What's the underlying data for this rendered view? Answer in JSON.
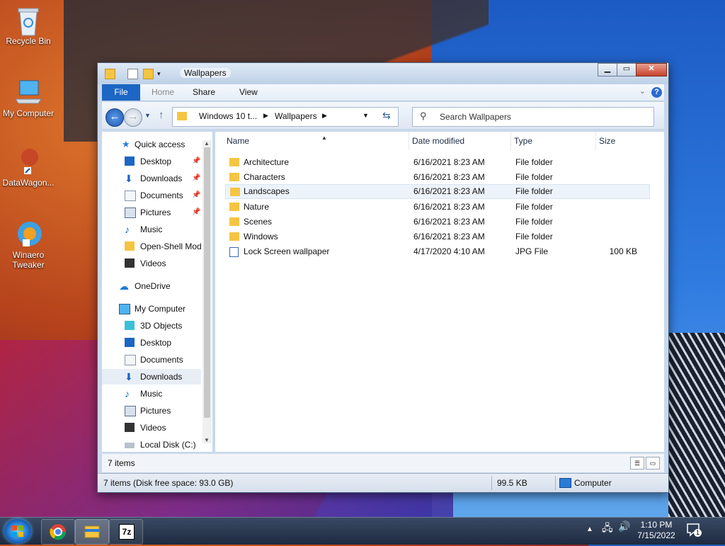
{
  "desktop": {
    "icons": [
      {
        "label": "Recycle Bin"
      },
      {
        "label": "My Computer"
      },
      {
        "label": "DataWagon..."
      },
      {
        "label": "Winaero Tweaker"
      }
    ]
  },
  "window": {
    "title": "Wallpapers",
    "ribbon": {
      "file": "File",
      "home": "Home",
      "share": "Share",
      "view": "View",
      "help": "?"
    },
    "address": {
      "crumbs": [
        "Windows 10 t...",
        "Wallpapers"
      ]
    },
    "search": {
      "placeholder": "Search Wallpapers"
    },
    "nav_pane": {
      "items": [
        {
          "label": "Quick access",
          "icon": "star-icon"
        },
        {
          "label": "Desktop",
          "icon": "desktop-icon",
          "pinned": true
        },
        {
          "label": "Downloads",
          "icon": "download-icon",
          "pinned": true
        },
        {
          "label": "Documents",
          "icon": "documents-icon",
          "pinned": true
        },
        {
          "label": "Pictures",
          "icon": "pictures-icon",
          "pinned": true
        },
        {
          "label": "Music",
          "icon": "music-icon"
        },
        {
          "label": "Open-Shell Mod",
          "icon": "folder-icon"
        },
        {
          "label": "Videos",
          "icon": "videos-icon"
        },
        {
          "label": "OneDrive",
          "icon": "cloud-icon"
        },
        {
          "label": "My Computer",
          "icon": "computer-icon"
        },
        {
          "label": "3D Objects",
          "icon": "cube-icon"
        },
        {
          "label": "Desktop",
          "icon": "desktop-icon"
        },
        {
          "label": "Documents",
          "icon": "documents-icon"
        },
        {
          "label": "Downloads",
          "icon": "download-icon",
          "selected": true
        },
        {
          "label": "Music",
          "icon": "music-icon"
        },
        {
          "label": "Pictures",
          "icon": "pictures-icon"
        },
        {
          "label": "Videos",
          "icon": "videos-icon"
        },
        {
          "label": "Local Disk (C:)",
          "icon": "disk-icon"
        }
      ]
    },
    "columns": {
      "name": "Name",
      "date": "Date modified",
      "type": "Type",
      "size": "Size"
    },
    "files": [
      {
        "name": "Architecture",
        "date": "6/16/2021 8:23 AM",
        "type": "File folder",
        "size": ""
      },
      {
        "name": "Characters",
        "date": "6/16/2021 8:23 AM",
        "type": "File folder",
        "size": ""
      },
      {
        "name": "Landscapes",
        "date": "6/16/2021 8:23 AM",
        "type": "File folder",
        "size": ""
      },
      {
        "name": "Nature",
        "date": "6/16/2021 8:23 AM",
        "type": "File folder",
        "size": ""
      },
      {
        "name": "Scenes",
        "date": "6/16/2021 8:23 AM",
        "type": "File folder",
        "size": ""
      },
      {
        "name": "Windows",
        "date": "6/16/2021 8:23 AM",
        "type": "File folder",
        "size": ""
      },
      {
        "name": "Lock Screen wallpaper",
        "date": "4/17/2020 4:10 AM",
        "type": "JPG File",
        "size": "100 KB"
      }
    ],
    "item_count": "7 items",
    "statusbar": {
      "info": "7 items (Disk free space: 93.0 GB)",
      "size": "99.5 KB",
      "location": "Computer"
    }
  },
  "taskbar": {
    "apps": [
      "chrome-icon",
      "explorer-icon",
      "7zip-icon"
    ],
    "sevenzip_label": "7z",
    "time": "1:10 PM",
    "date": "7/15/2022",
    "notifications": "1"
  },
  "colors": {
    "accent": "#1c66c4",
    "folder": "#f5c542"
  }
}
